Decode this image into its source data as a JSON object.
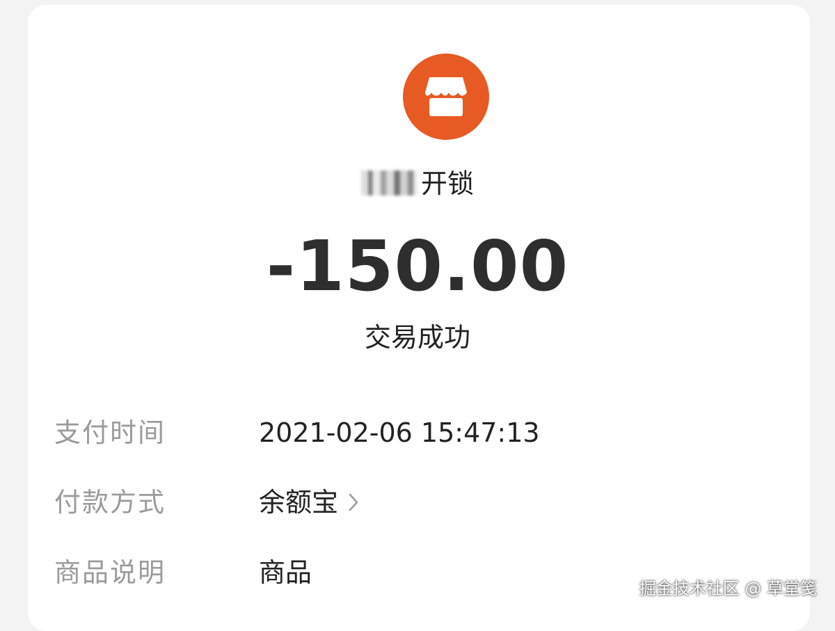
{
  "merchant": {
    "icon": "storefront-icon",
    "icon_color": "#e75a24",
    "name_blurred": "censored-merchant-name",
    "name_suffix": "开锁"
  },
  "transaction": {
    "amount": "-150.00",
    "status": "交易成功"
  },
  "details": [
    {
      "label": "支付时间",
      "value": "2021-02-06 15:47:13"
    },
    {
      "label": "付款方式",
      "value": "余额宝",
      "icon": "chevron-right-icon"
    },
    {
      "label": "商品说明",
      "value": "商品"
    }
  ],
  "watermark": "掘金技术社区 @ 草堂笺"
}
